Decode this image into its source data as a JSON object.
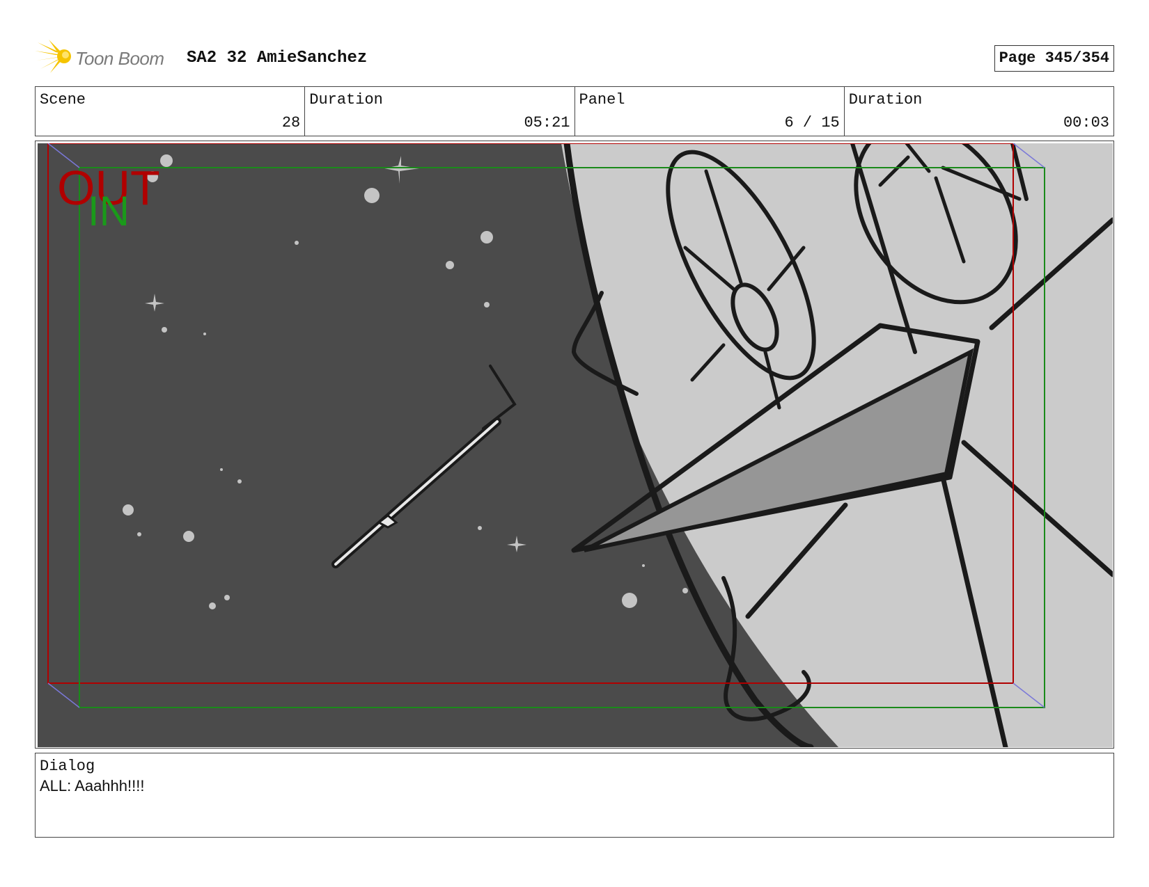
{
  "header": {
    "logo_text": "Toon Boom",
    "project_title": "SA2 32 AmieSanchez",
    "page_label": "Page 345/354"
  },
  "info": {
    "scene_label": "Scene",
    "scene_value": "28",
    "scene_duration_label": "Duration",
    "scene_duration_value": "05:21",
    "panel_label": "Panel",
    "panel_value": "6 / 15",
    "panel_duration_label": "Duration",
    "panel_duration_value": "00:03"
  },
  "panel": {
    "out_label": "OUT",
    "in_label": "IN",
    "colors": {
      "space": "#4b4b4b",
      "ship": "#cbcbcb",
      "out_frame": "#b00000",
      "in_frame": "#1a8a1a"
    }
  },
  "dialog": {
    "label": "Dialog",
    "text": "ALL: Aaahhh!!!!"
  }
}
